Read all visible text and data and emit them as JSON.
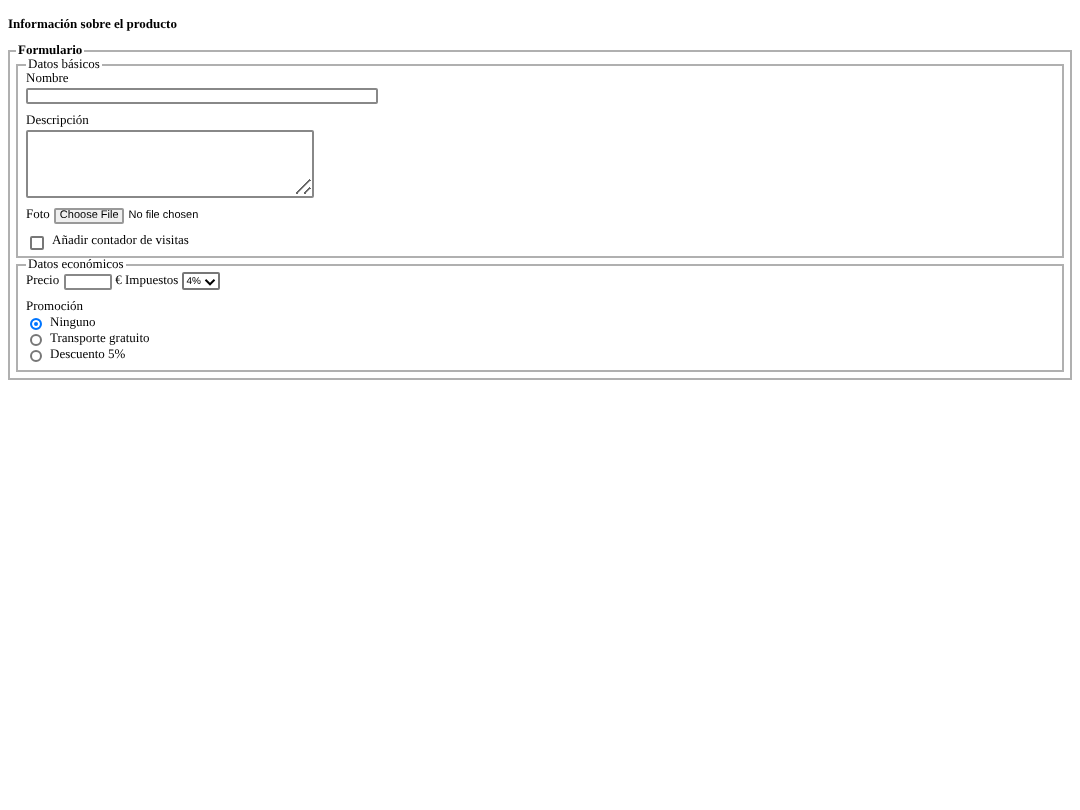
{
  "heading": "Información sobre el producto",
  "form": {
    "legend": "Formulario",
    "basic": {
      "legend": "Datos básicos",
      "name_label": "Nombre",
      "description_label": "Descripción",
      "photo_label": "Foto",
      "file_button": "Choose File",
      "file_status": "No file chosen",
      "visits_checkbox": {
        "label": "Añadir contador de visitas",
        "checked": false
      }
    },
    "economic": {
      "legend": "Datos económicos",
      "price_label": "Precio",
      "currency_taxes_label": "€ Impuestos",
      "taxes_select": "4%",
      "promotion_label": "Promoción",
      "promotions": [
        {
          "label": "Ninguno",
          "selected": true
        },
        {
          "label": "Transporte gratuito",
          "selected": false
        },
        {
          "label": "Descuento 5%",
          "selected": false
        }
      ]
    }
  }
}
